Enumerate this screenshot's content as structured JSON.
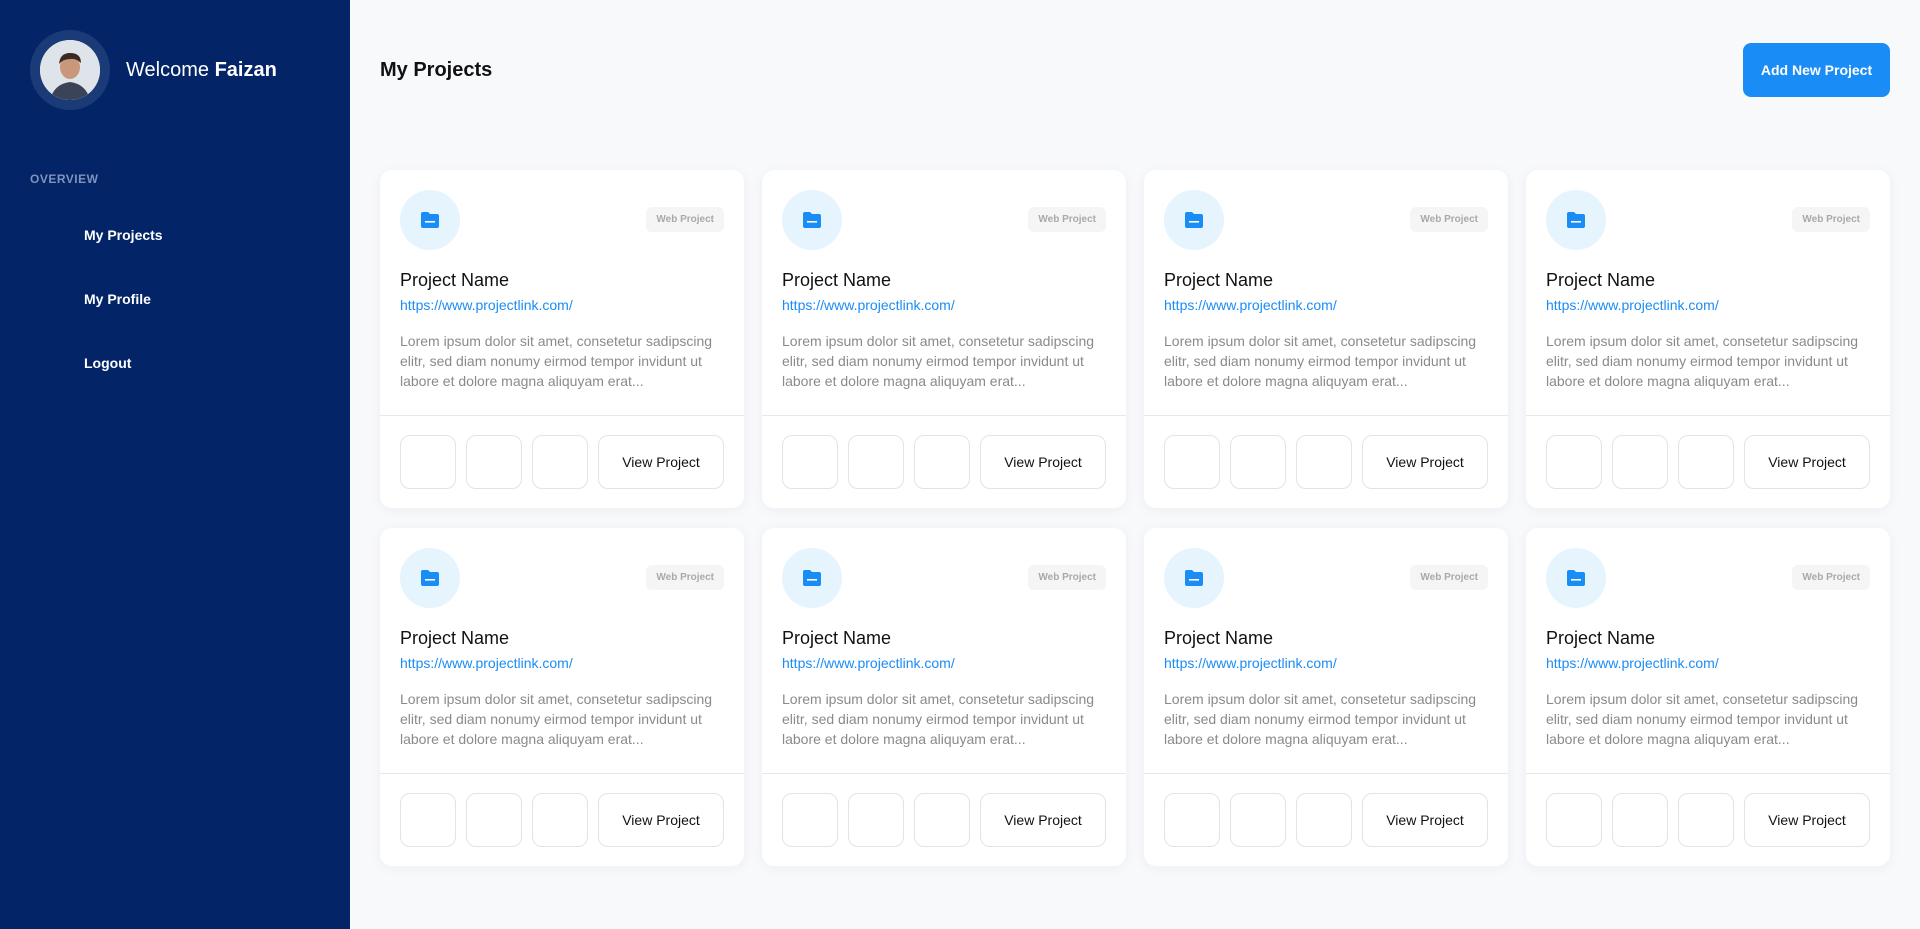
{
  "colors": {
    "sidebar_bg": "#032466",
    "accent": "#1a8cf5",
    "page_bg": "#f8f9fb"
  },
  "sidebar": {
    "welcome_prefix": "Welcome",
    "user_name": "Faizan",
    "section_label": "OVERVIEW",
    "items": [
      {
        "label": "My Projects"
      },
      {
        "label": "My Profile"
      },
      {
        "label": "Logout"
      }
    ]
  },
  "header": {
    "title": "My Projects",
    "add_button": "Add New Project"
  },
  "projects": [
    {
      "badge": "Web Project",
      "name": "Project Name",
      "link": "https://www.projectlink.com/",
      "description": "Lorem ipsum dolor sit amet, consetetur sadipscing elitr, sed diam nonumy eirmod tempor invidunt ut labore et dolore magna aliquyam erat...",
      "action": "View Project",
      "icon": "folder-icon"
    },
    {
      "badge": "Web Project",
      "name": "Project Name",
      "link": "https://www.projectlink.com/",
      "description": "Lorem ipsum dolor sit amet, consetetur sadipscing elitr, sed diam nonumy eirmod tempor invidunt ut labore et dolore magna aliquyam erat...",
      "action": "View Project",
      "icon": "folder-icon"
    },
    {
      "badge": "Web Project",
      "name": "Project Name",
      "link": "https://www.projectlink.com/",
      "description": "Lorem ipsum dolor sit amet, consetetur sadipscing elitr, sed diam nonumy eirmod tempor invidunt ut labore et dolore magna aliquyam erat...",
      "action": "View Project",
      "icon": "folder-icon"
    },
    {
      "badge": "Web Project",
      "name": "Project Name",
      "link": "https://www.projectlink.com/",
      "description": "Lorem ipsum dolor sit amet, consetetur sadipscing elitr, sed diam nonumy eirmod tempor invidunt ut labore et dolore magna aliquyam erat...",
      "action": "View Project",
      "icon": "folder-icon"
    },
    {
      "badge": "Web Project",
      "name": "Project Name",
      "link": "https://www.projectlink.com/",
      "description": "Lorem ipsum dolor sit amet, consetetur sadipscing elitr, sed diam nonumy eirmod tempor invidunt ut labore et dolore magna aliquyam erat...",
      "action": "View Project",
      "icon": "folder-icon"
    },
    {
      "badge": "Web Project",
      "name": "Project Name",
      "link": "https://www.projectlink.com/",
      "description": "Lorem ipsum dolor sit amet, consetetur sadipscing elitr, sed diam nonumy eirmod tempor invidunt ut labore et dolore magna aliquyam erat...",
      "action": "View Project",
      "icon": "folder-icon"
    },
    {
      "badge": "Web Project",
      "name": "Project Name",
      "link": "https://www.projectlink.com/",
      "description": "Lorem ipsum dolor sit amet, consetetur sadipscing elitr, sed diam nonumy eirmod tempor invidunt ut labore et dolore magna aliquyam erat...",
      "action": "View Project",
      "icon": "folder-icon"
    },
    {
      "badge": "Web Project",
      "name": "Project Name",
      "link": "https://www.projectlink.com/",
      "description": "Lorem ipsum dolor sit amet, consetetur sadipscing elitr, sed diam nonumy eirmod tempor invidunt ut labore et dolore magna aliquyam erat...",
      "action": "View Project",
      "icon": "folder-icon"
    }
  ]
}
